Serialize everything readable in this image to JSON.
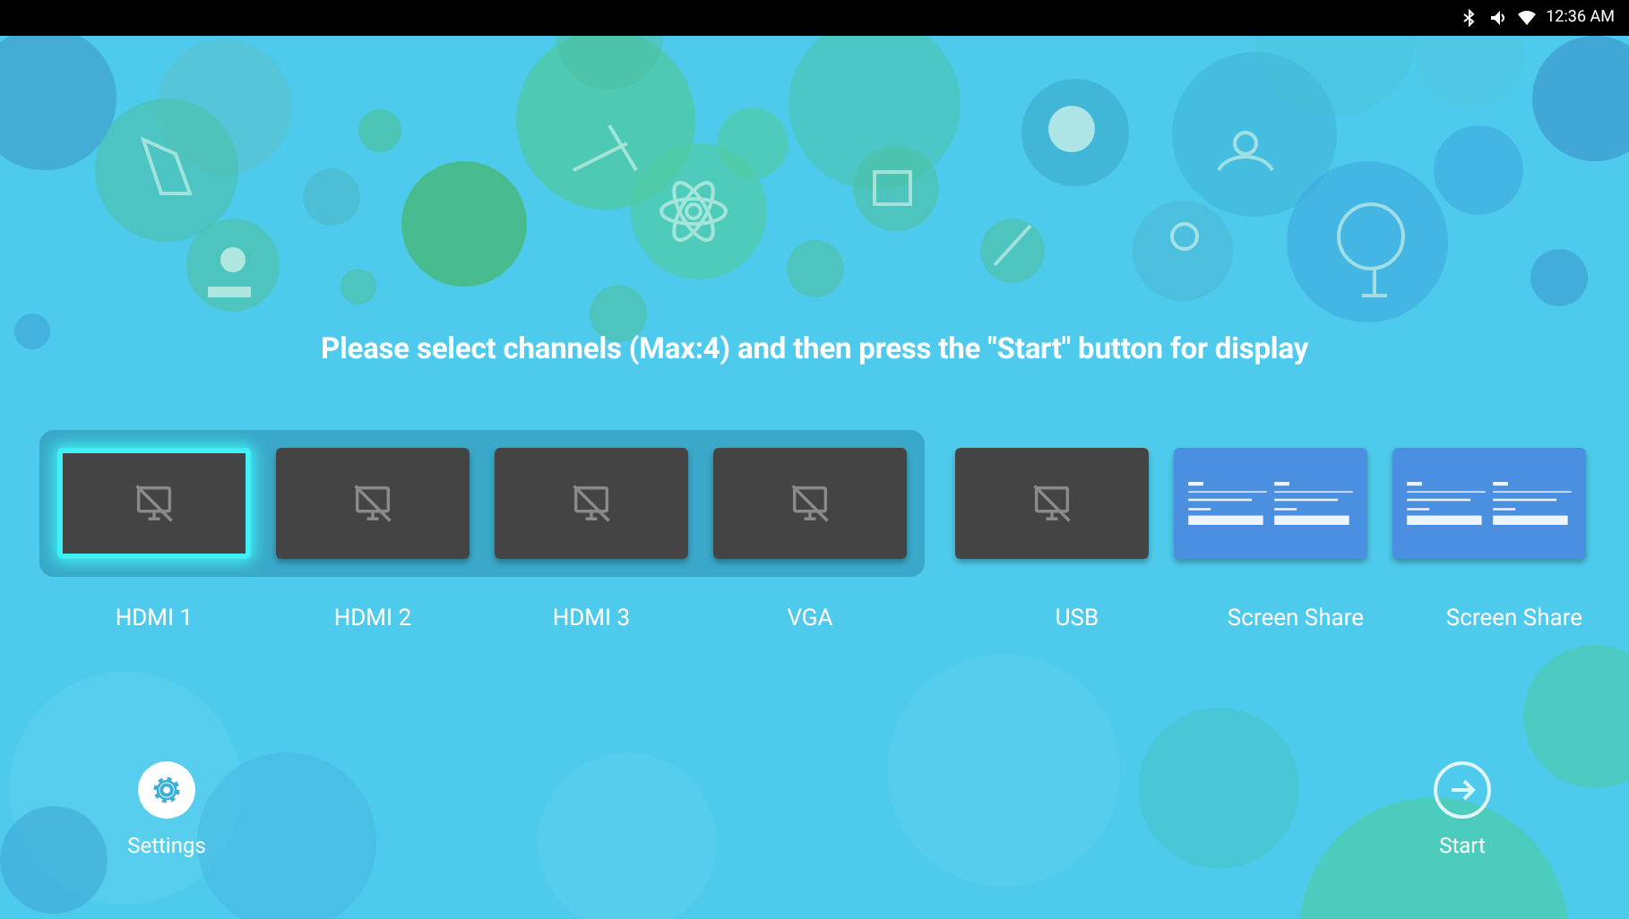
{
  "status_bar": {
    "time": "12:36 AM"
  },
  "prompt": "Please select channels (Max:4) and then press the \"Start\" button for display",
  "channel_group": [
    {
      "label": "HDMI 1",
      "kind": "input",
      "selected": true
    },
    {
      "label": "HDMI 2",
      "kind": "input",
      "selected": false
    },
    {
      "label": "HDMI 3",
      "kind": "input",
      "selected": false
    },
    {
      "label": "VGA",
      "kind": "input",
      "selected": false
    }
  ],
  "other_channels": [
    {
      "label": "USB",
      "kind": "input",
      "selected": false
    },
    {
      "label": "Screen Share",
      "kind": "screen_share",
      "selected": false
    },
    {
      "label": "Screen Share",
      "kind": "screen_share",
      "selected": false
    }
  ],
  "settings": {
    "label": "Settings"
  },
  "start": {
    "label": "Start"
  }
}
